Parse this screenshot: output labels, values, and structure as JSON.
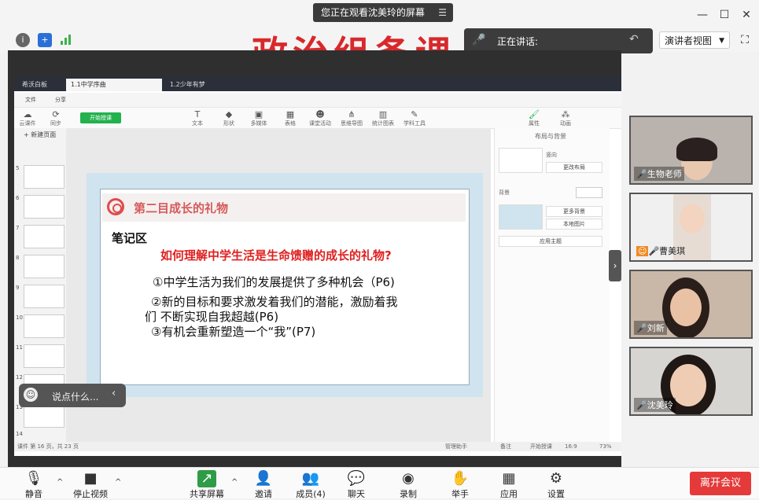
{
  "topbar": {
    "banner_text": "您正在观看沈美玲的屏幕",
    "speaking_label": "正在讲话:",
    "presenter_view": "演讲者视图"
  },
  "overlay_title": "政治组备课",
  "app": {
    "tabs": [
      "希沃白板",
      "1.1中学序曲",
      "1.2少年有梦"
    ],
    "menu": [
      "文件",
      "分享"
    ],
    "ribbon_left": [
      "云课件",
      "同步"
    ],
    "start_button": "开始授课",
    "ribbon": [
      "文本",
      "形状",
      "多媒体",
      "表格",
      "课堂活动",
      "思维导图",
      "统计图表",
      "学科工具"
    ],
    "ribbon_right": [
      "属性",
      "动画"
    ],
    "new_page": "新建页面",
    "thumb_numbers": [
      "5",
      "6",
      "7",
      "8",
      "9",
      "10",
      "11",
      "12",
      "13",
      "14"
    ],
    "panel": {
      "section1": "布局与背景",
      "layout": "竖向",
      "change_layout": "更改布局",
      "bg_label": "背景",
      "more_bg": "更多背景",
      "local_img": "本地图片",
      "apply_theme": "应用主题"
    },
    "status_left": "课件 第 16 页，共 23 页",
    "status_right": [
      "管理助手",
      "备注",
      "开始授课",
      "16:9",
      "73%"
    ]
  },
  "slide": {
    "title": "第二目成长的礼物",
    "notes_label": "笔记区",
    "question": "如何理解中学生活是生命馈赠的成长的礼物?",
    "points": [
      "①中学生活为我们的发展提供了多种机会（P6)",
      "②新的目标和要求激发着我们的潜能，激励着我",
      "们   不断实现自我超越(P6)",
      "③有机会重新塑造一个“我”(P7)"
    ]
  },
  "chat": {
    "placeholder": "说点什么..."
  },
  "participants": [
    {
      "name": "生物老师"
    },
    {
      "name": "曹美琪"
    },
    {
      "name": "刘新"
    },
    {
      "name": "沈美玲"
    }
  ],
  "bottom": {
    "mute": "静音",
    "stop_video": "停止视频",
    "share_screen": "共享屏幕",
    "invite": "邀请",
    "members": "成员(4)",
    "chat": "聊天",
    "record": "录制",
    "raise_hand": "举手",
    "apps": "应用",
    "settings": "设置",
    "leave": "离开会议"
  },
  "colors": {
    "accent_red": "#e43a3a",
    "title_red": "#d8282b",
    "green": "#22b14c"
  }
}
